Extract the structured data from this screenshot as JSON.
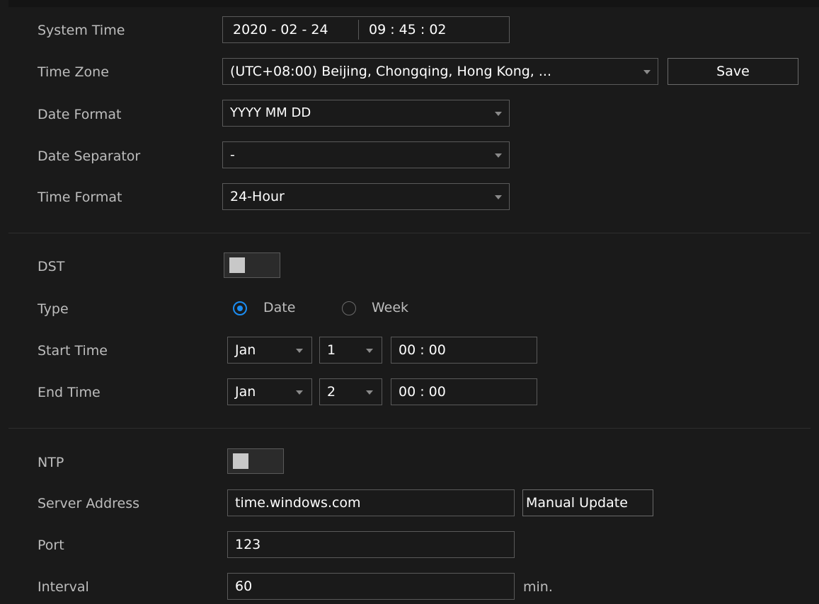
{
  "system_time": {
    "label": "System Time",
    "date": "2020  - 02 - 24",
    "time": "09 : 45 : 02"
  },
  "time_zone": {
    "label": "Time Zone",
    "value": "(UTC+08:00) Beijing, Chongqing, Hong Kong, ...",
    "save_label": "Save"
  },
  "date_format": {
    "label": "Date Format",
    "value": "YYYY MM DD"
  },
  "date_separator": {
    "label": "Date Separator",
    "value": "-"
  },
  "time_format": {
    "label": "Time Format",
    "value": "24-Hour"
  },
  "dst": {
    "label": "DST",
    "enabled": false,
    "type_label": "Type",
    "type_options": [
      "Date",
      "Week"
    ],
    "type_selected": "Date",
    "start": {
      "label": "Start Time",
      "month": "Jan",
      "day": "1",
      "time": "00 : 00"
    },
    "end": {
      "label": "End Time",
      "month": "Jan",
      "day": "2",
      "time": "00 : 00"
    }
  },
  "ntp": {
    "label": "NTP",
    "enabled": false,
    "server_label": "Server Address",
    "server_value": "time.windows.com",
    "manual_update_label": "Manual Update",
    "port_label": "Port",
    "port_value": "123",
    "interval_label": "Interval",
    "interval_value": "60",
    "interval_unit": "min."
  },
  "colors": {
    "background": "#1a1a1a",
    "border": "#5a5a5a",
    "accent": "#1b8cf0",
    "label_text": "#bdbdbd",
    "value_text": "#ffffff"
  }
}
